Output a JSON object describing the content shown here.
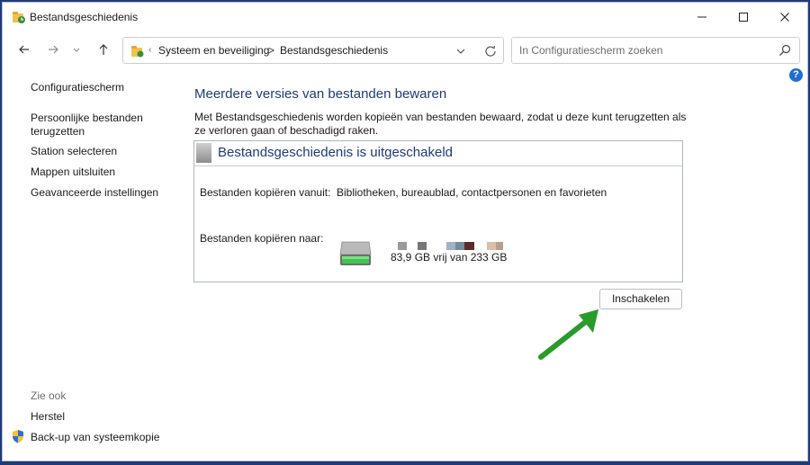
{
  "window": {
    "title": "Bestandsgeschiedenis",
    "controls": {
      "minimize": "minimize-icon",
      "maximize": "maximize-icon",
      "close": "close-icon"
    }
  },
  "navbar": {
    "address": {
      "separator": "‹",
      "crumb_separator": ">",
      "breadcrumbs": [
        "Systeem en beveiliging",
        "Bestandsgeschiedenis"
      ]
    },
    "search": {
      "placeholder": "In Configuratiescherm zoeken"
    }
  },
  "help": {
    "label": "?"
  },
  "sidebar": {
    "home": "Configuratiescherm",
    "items": [
      "Persoonlijke bestanden terugzetten",
      "Station selecteren",
      "Mappen uitsluiten",
      "Geavanceerde instellingen"
    ],
    "see_also_title": "Zie ook",
    "see_also": [
      "Herstel",
      "Back-up van systeemkopie"
    ]
  },
  "main": {
    "title": "Meerdere versies van bestanden bewaren",
    "description": "Met Bestandsgeschiedenis worden kopieën van bestanden bewaard, zodat u deze kunt terugzetten als ze verloren gaan of beschadigd raken.",
    "panel": {
      "header": "Bestandsgeschiedenis is uitgeschakeld",
      "copy_from_label": "Bestanden kopiëren vanuit:",
      "copy_from_value": "Bibliotheken, bureaublad, contactpersonen en favorieten",
      "copy_to_label": "Bestanden kopiëren naar:",
      "drive_space": "83,9 GB vrij van 233 GB"
    },
    "enable_button": "Inschakelen"
  },
  "colors": {
    "accent": "#1e3a78",
    "arrow": "#2a9a2a",
    "desktop": "#1d3b78"
  }
}
